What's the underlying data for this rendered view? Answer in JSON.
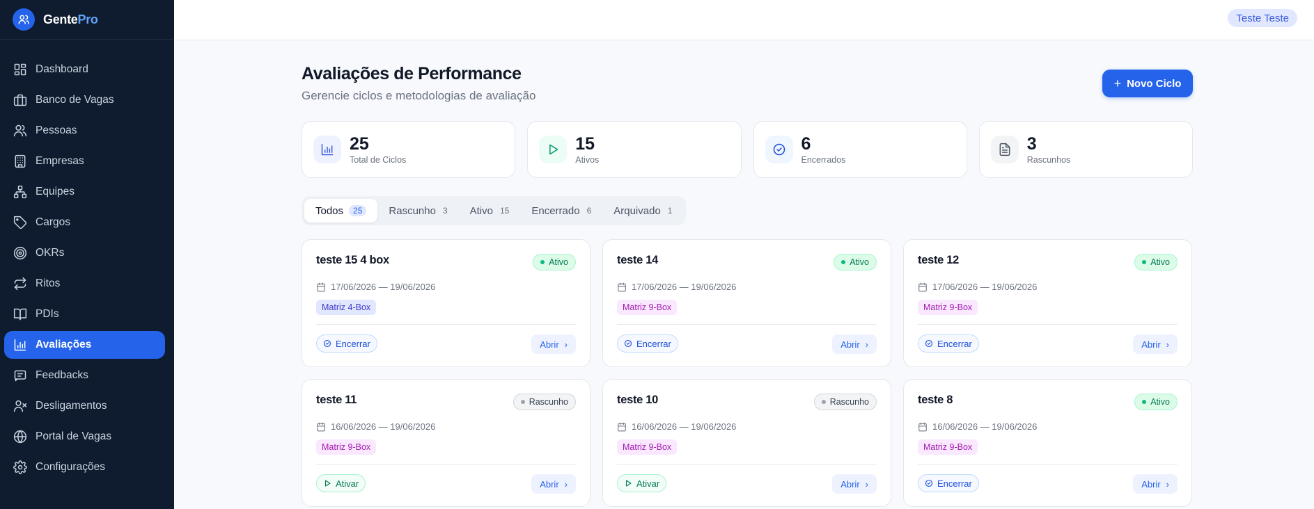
{
  "brand": {
    "name_part1": "Gente",
    "name_part2": "Pro"
  },
  "sidebar": {
    "items": [
      {
        "label": "Dashboard",
        "icon": "dashboard-icon"
      },
      {
        "label": "Banco de Vagas",
        "icon": "briefcase-icon"
      },
      {
        "label": "Pessoas",
        "icon": "users-icon"
      },
      {
        "label": "Empresas",
        "icon": "building-icon"
      },
      {
        "label": "Equipes",
        "icon": "network-icon"
      },
      {
        "label": "Cargos",
        "icon": "tag-icon"
      },
      {
        "label": "OKRs",
        "icon": "target-icon"
      },
      {
        "label": "Ritos",
        "icon": "repeat-icon"
      },
      {
        "label": "PDIs",
        "icon": "book-icon"
      },
      {
        "label": "Avaliações",
        "icon": "bar-chart-icon",
        "active": true
      },
      {
        "label": "Feedbacks",
        "icon": "message-icon"
      },
      {
        "label": "Desligamentos",
        "icon": "user-x-icon"
      },
      {
        "label": "Portal de Vagas",
        "icon": "globe-icon"
      },
      {
        "label": "Configurações",
        "icon": "gear-icon"
      }
    ]
  },
  "header": {
    "user": "Teste Teste"
  },
  "page": {
    "title": "Avaliações de Performance",
    "subtitle": "Gerencie ciclos e metodologias de avaliação",
    "new_button": "Novo Ciclo"
  },
  "stats": [
    {
      "value": "25",
      "label": "Total de Ciclos",
      "icon": "bar-chart-icon",
      "color": "#3b5bdb",
      "bg": "#eef2ff"
    },
    {
      "value": "15",
      "label": "Ativos",
      "icon": "play-icon",
      "color": "#059669",
      "bg": "#ecfdf5"
    },
    {
      "value": "6",
      "label": "Encerrados",
      "icon": "check-circle-icon",
      "color": "#1d4ed8",
      "bg": "#eff6ff"
    },
    {
      "value": "3",
      "label": "Rascunhos",
      "icon": "document-icon",
      "color": "#4b5563",
      "bg": "#f3f4f6"
    }
  ],
  "tabs": [
    {
      "label": "Todos",
      "count": "25",
      "active": true
    },
    {
      "label": "Rascunho",
      "count": "3"
    },
    {
      "label": "Ativo",
      "count": "15"
    },
    {
      "label": "Encerrado",
      "count": "6"
    },
    {
      "label": "Arquivado",
      "count": "1"
    }
  ],
  "cards": [
    {
      "title": "teste 15 4 box",
      "status": "Ativo",
      "status_kind": "ativo",
      "dates": "17/06/2026 — 19/06/2026",
      "method": "Matriz 4-Box",
      "method_kind": "box4",
      "action": "Encerrar",
      "action_kind": "encerrar",
      "open": "Abrir"
    },
    {
      "title": "teste 14",
      "status": "Ativo",
      "status_kind": "ativo",
      "dates": "17/06/2026 — 19/06/2026",
      "method": "Matriz 9-Box",
      "method_kind": "box9",
      "action": "Encerrar",
      "action_kind": "encerrar",
      "open": "Abrir"
    },
    {
      "title": "teste 12",
      "status": "Ativo",
      "status_kind": "ativo",
      "dates": "17/06/2026 — 19/06/2026",
      "method": "Matriz 9-Box",
      "method_kind": "box9",
      "action": "Encerrar",
      "action_kind": "encerrar",
      "open": "Abrir"
    },
    {
      "title": "teste 11",
      "status": "Rascunho",
      "status_kind": "rascunho",
      "dates": "16/06/2026 — 19/06/2026",
      "method": "Matriz 9-Box",
      "method_kind": "box9",
      "action": "Ativar",
      "action_kind": "ativar",
      "open": "Abrir"
    },
    {
      "title": "teste 10",
      "status": "Rascunho",
      "status_kind": "rascunho",
      "dates": "16/06/2026 — 19/06/2026",
      "method": "Matriz 9-Box",
      "method_kind": "box9",
      "action": "Ativar",
      "action_kind": "ativar",
      "open": "Abrir"
    },
    {
      "title": "teste 8",
      "status": "Ativo",
      "status_kind": "ativo",
      "dates": "16/06/2026 — 19/06/2026",
      "method": "Matriz 9-Box",
      "method_kind": "box9",
      "action": "Encerrar",
      "action_kind": "encerrar",
      "open": "Abrir"
    }
  ]
}
